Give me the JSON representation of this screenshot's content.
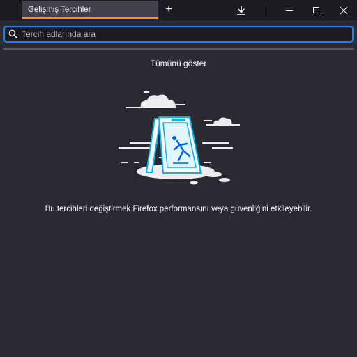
{
  "tab": {
    "title": "Gelişmiş Tercihler"
  },
  "toolbar": {
    "new_tab_label": "+",
    "icons": [
      "download-icon",
      "minimize-icon",
      "maximize-icon",
      "close-icon"
    ]
  },
  "search": {
    "placeholder": "Tercih adlarında ara",
    "value": ""
  },
  "main": {
    "show_all": "Tümünü göster",
    "warning": "Bu tercihleri değiştirmek Firefox performansını veya güvenliğini etkileyebilir."
  },
  "colors": {
    "background": "#2b2a33",
    "tabstrip": "#1c1b22",
    "active_tab": "#42414d",
    "tab_accent": "#ff9400",
    "focus_ring": "#0a84ff",
    "illustration_blue": "#00b3f4"
  }
}
